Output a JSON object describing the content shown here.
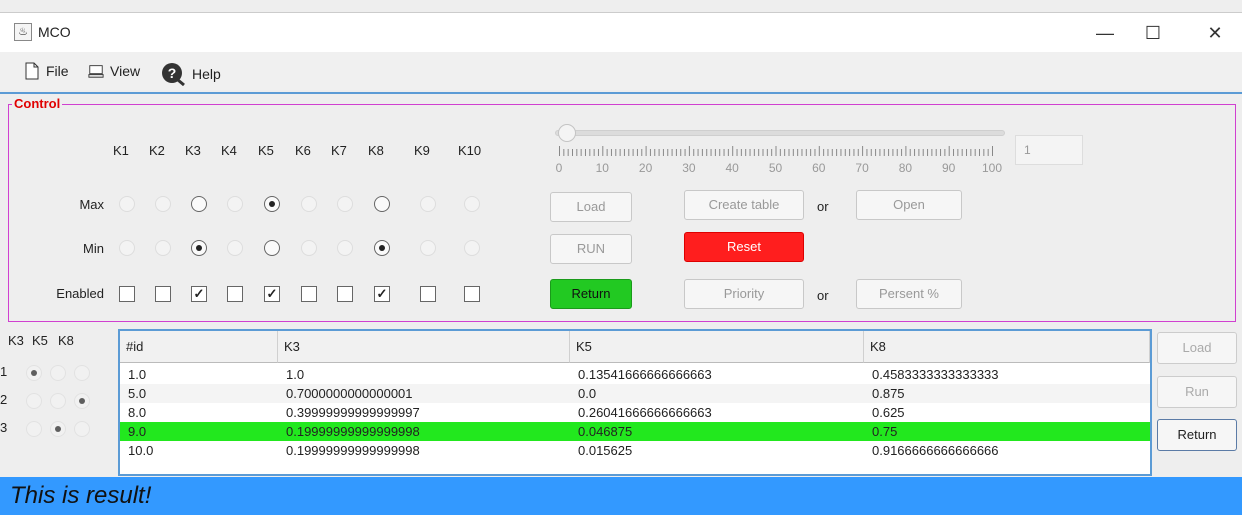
{
  "window": {
    "title": "MCO",
    "minimize": "—",
    "maximize": "☐",
    "close": "✕"
  },
  "menu": [
    {
      "label": "File",
      "icon": "document-icon"
    },
    {
      "label": "View",
      "icon": "monitor-icon"
    },
    {
      "label": "Help",
      "icon": "help-icon"
    }
  ],
  "control": {
    "legend": "Control",
    "criteria": [
      "K1",
      "K2",
      "K3",
      "K4",
      "K5",
      "K6",
      "K7",
      "K8",
      "K9",
      "K10"
    ],
    "row_labels": {
      "max": "Max",
      "min": "Min",
      "enabled": "Enabled"
    },
    "max_selected": "K5",
    "min_selected": [
      "K3",
      "K8"
    ],
    "enabled": [
      "K3",
      "K5",
      "K8"
    ],
    "enabled_mark": "✓",
    "slider": {
      "ticks": [
        "0",
        "10",
        "20",
        "30",
        "40",
        "50",
        "60",
        "70",
        "80",
        "90",
        "100"
      ],
      "value": "1"
    },
    "buttons": {
      "load": "Load",
      "create_table": "Create table",
      "or1": "or",
      "open": "Open",
      "run": "RUN",
      "reset": "Reset",
      "return": "Return",
      "priority": "Priority",
      "or2": "or",
      "persent": "Persent %"
    }
  },
  "weights": {
    "headers": [
      "K3",
      "K5",
      "K8"
    ],
    "rows": [
      {
        "num": "1",
        "selected": "K3"
      },
      {
        "num": "2",
        "selected": "K8"
      },
      {
        "num": "3",
        "selected": "K5"
      }
    ]
  },
  "table": {
    "columns": [
      "#id",
      "K3",
      "K5",
      "K8"
    ],
    "rows": [
      [
        "1.0",
        "1.0",
        "0.13541666666666663",
        "0.4583333333333333"
      ],
      [
        "5.0",
        "0.7000000000000001",
        "0.0",
        "0.875"
      ],
      [
        "8.0",
        "0.39999999999999997",
        "0.26041666666666663",
        "0.625"
      ],
      [
        "9.0",
        "0.19999999999999998",
        "0.046875",
        "0.75"
      ],
      [
        "10.0",
        "0.19999999999999998",
        "0.015625",
        "0.9166666666666666"
      ]
    ],
    "highlight_row": 3,
    "highlight_color": "#22e81e"
  },
  "side_buttons": {
    "load": "Load",
    "run": "Run",
    "return": "Return"
  },
  "status": {
    "text": "This is result!",
    "color": "#3399ff"
  }
}
